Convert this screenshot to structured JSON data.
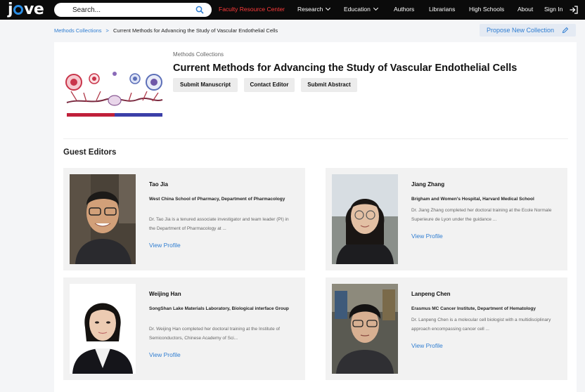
{
  "nav": {
    "logo": "jove",
    "search_placeholder": "Search...",
    "faculty": "Faculty Resource Center",
    "research": "Research",
    "education": "Education",
    "authors": "Authors",
    "librarians": "Librarians",
    "high_schools": "High Schools",
    "about": "About",
    "sign_in": "Sign In",
    "faculty_color": "#ff3b3b"
  },
  "breadcrumb": {
    "parent": "Methods Collections",
    "separator": ">",
    "current": "Current Methods for Advancing the Study of Vascular Endothelial Cells"
  },
  "propose_button": "Propose New Collection",
  "collection": {
    "kicker": "Methods Collections",
    "title": "Current Methods for Advancing the Study of Vascular Endothelial Cells",
    "buttons": {
      "submit_manuscript": "Submit Manuscript",
      "contact_editor": "Contact Editor",
      "submit_abstract": "Submit Abstract"
    }
  },
  "guest_editors": {
    "heading": "Guest Editors",
    "editors": [
      {
        "name": "Tao Jia",
        "affiliation": "West China School of Pharmacy, Department of Pharmacology",
        "bio": "Dr. Tao Jia is a tenured associate investigator and team leader (PI) in the Department of Pharmacology at ...",
        "link": "View Profile"
      },
      {
        "name": "Jiang Zhang",
        "affiliation": "Brigham and Women's Hospital, Harvard Medical School",
        "bio": "Dr. Jiang Zhang completed her doctoral training at the Ecole Normale Superieure de Lyon under the guidance ...",
        "link": "View Profile"
      },
      {
        "name": "Weijing Han",
        "affiliation": "SongShan Lake Materials Laboratory, Biological interface Group",
        "bio": "Dr. Weijing Han completed her doctoral training at the Institute of Semiconductors, Chinese Academy of Sci...",
        "link": "View Profile"
      },
      {
        "name": "Lanpeng Chen",
        "affiliation": "Erasmus MC Cancer Institute, Department of Hematology",
        "bio": "Dr. Lanpeng Chen is a molecular cell biologist with a multidisciplinary approach encompassing cancer cell ...",
        "link": "View Profile"
      }
    ]
  },
  "colors": {
    "accent": "#2f7dd1",
    "nav_bg": "#0b0b0b"
  }
}
